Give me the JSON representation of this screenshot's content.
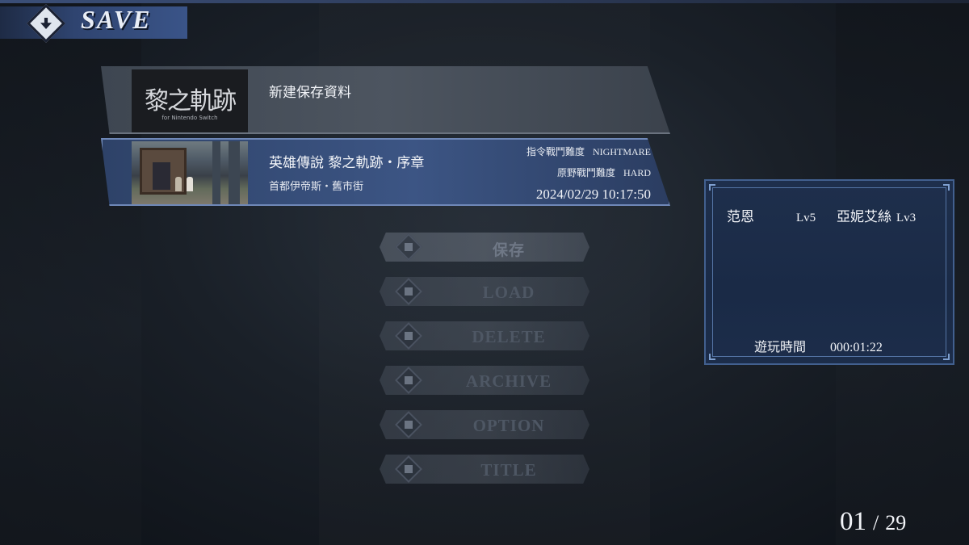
{
  "header": {
    "title": "SAVE",
    "icon": "save-icon"
  },
  "slots": [
    {
      "title": "新建保存資料",
      "thumb_text": "黎之軌跡",
      "thumb_sub": "for Nintendo Switch"
    },
    {
      "title": "英雄傳說  黎之軌跡・序章",
      "location": "首都伊帝斯・舊市街",
      "command_label": "指令戰鬥難度",
      "command_value": "NIGHTMARE",
      "field_label": "原野戰鬥難度",
      "field_value": "HARD",
      "datetime": "2024/02/29  10:17:50"
    }
  ],
  "menu": [
    {
      "label": "保存",
      "icon": "save-icon"
    },
    {
      "label": "LOAD",
      "icon": "load-icon"
    },
    {
      "label": "DELETE",
      "icon": "delete-icon"
    },
    {
      "label": "ARCHIVE",
      "icon": "archive-icon"
    },
    {
      "label": "OPTION",
      "icon": "wrench-icon"
    },
    {
      "label": "TITLE",
      "icon": "door-icon"
    }
  ],
  "party": {
    "members": [
      {
        "name": "范恩",
        "level": "Lv5"
      },
      {
        "name": "亞妮艾絲",
        "level": "Lv3"
      }
    ],
    "playtime_label": "遊玩時間",
    "playtime_value": "000:01:22"
  },
  "page": {
    "current": "01",
    "separator": "/",
    "total": "29"
  },
  "colors": {
    "accent": "#3c5584",
    "panel": "#1e2f4c"
  }
}
